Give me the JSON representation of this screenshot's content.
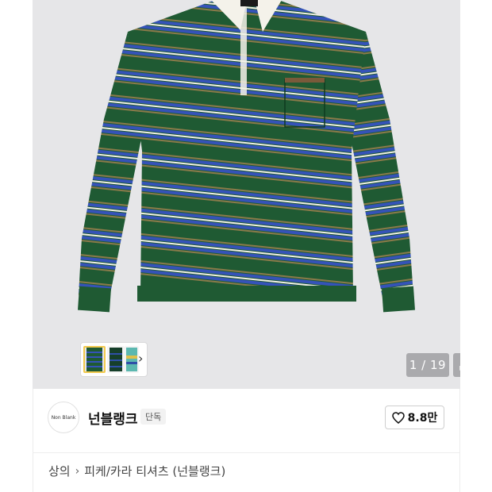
{
  "gallery": {
    "counter": "1 / 19",
    "thumbnail_count": 3,
    "colors": {
      "background": "#e6e6e8",
      "shirt_green": "#1f5a33",
      "stripe_blue": "#3553b8",
      "collar": "#f4f2ea"
    }
  },
  "brand": {
    "logo_text": "Non Blank",
    "name": "넌블랭크",
    "badge": "단독"
  },
  "like": {
    "count": "8.8만"
  },
  "breadcrumb": {
    "items": [
      "상의",
      "피케/카라 티셔츠 (넌블랭크)"
    ]
  },
  "icons": [
    "chevron-right-icon",
    "expand-icon",
    "heart-icon"
  ]
}
